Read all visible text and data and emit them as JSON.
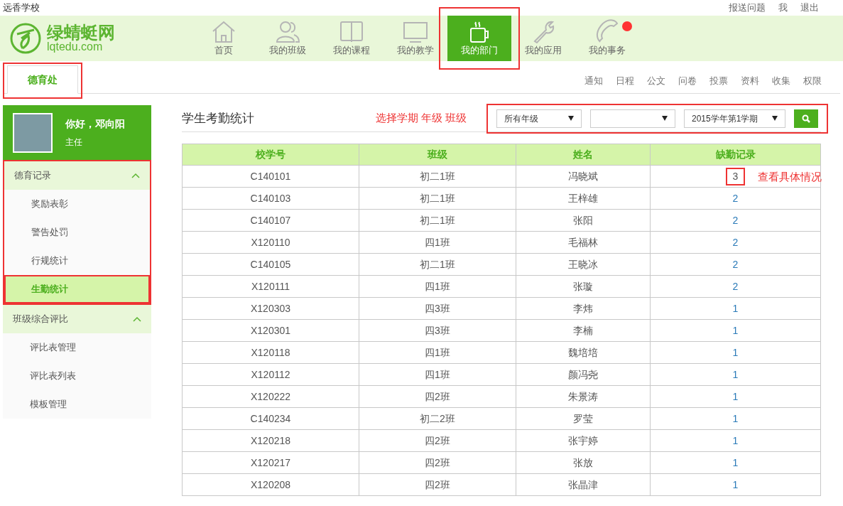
{
  "school_name": "远香学校",
  "top_links": [
    "报送问题",
    "我",
    "退出"
  ],
  "logo": {
    "name": "绿蜻蜓网",
    "domain": "lqtedu.com"
  },
  "nav": [
    {
      "label": "首页",
      "kind": "home",
      "selected": false,
      "badge": false,
      "annotated": false
    },
    {
      "label": "我的班级",
      "kind": "people",
      "selected": false,
      "badge": false,
      "annotated": false
    },
    {
      "label": "我的课程",
      "kind": "book",
      "selected": false,
      "badge": false,
      "annotated": false
    },
    {
      "label": "我的教学",
      "kind": "monitor",
      "selected": false,
      "badge": false,
      "annotated": false
    },
    {
      "label": "我的部门",
      "kind": "cup",
      "selected": true,
      "badge": false,
      "annotated": true
    },
    {
      "label": "我的应用",
      "kind": "wrench",
      "selected": false,
      "badge": false,
      "annotated": false
    },
    {
      "label": "我的事务",
      "kind": "phone",
      "selected": false,
      "badge": true,
      "annotated": false
    }
  ],
  "dept_tab": {
    "label": "德育处",
    "selected": true,
    "annotated": true
  },
  "sub_nav": [
    "通知",
    "日程",
    "公文",
    "问卷",
    "投票",
    "资料",
    "收集",
    "权限"
  ],
  "user": {
    "greeting": "你好，邓向阳",
    "role": "主任"
  },
  "sidebar": [
    {
      "title": "德育记录",
      "expanded": true,
      "annotated": true,
      "children": [
        {
          "label": "奖励表彰",
          "selected": false,
          "annotated": false
        },
        {
          "label": "警告处罚",
          "selected": false,
          "annotated": false
        },
        {
          "label": "行规统计",
          "selected": false,
          "annotated": false
        },
        {
          "label": "生勤统计",
          "selected": true,
          "annotated": true
        }
      ]
    },
    {
      "title": "班级综合评比",
      "expanded": true,
      "annotated": false,
      "children": [
        {
          "label": "评比表管理",
          "selected": false,
          "annotated": false
        },
        {
          "label": "评比表列表",
          "selected": false,
          "annotated": false
        },
        {
          "label": "模板管理",
          "selected": false,
          "annotated": false
        }
      ]
    }
  ],
  "page_title": "学生考勤统计",
  "filter_note": "选择学期 年级 班级",
  "filters": {
    "annotated": true,
    "grade": "所有年级",
    "term": "2015学年第1学期"
  },
  "table": {
    "columns": [
      "校学号",
      "班级",
      "姓名",
      "缺勤记录"
    ],
    "rows": [
      {
        "id": "C140101",
        "class": "初二1班",
        "name": "冯晓斌",
        "absences": "3",
        "annotated": true,
        "note": "查看具体情况"
      },
      {
        "id": "C140103",
        "class": "初二1班",
        "name": "王梓雄",
        "absences": "2",
        "annotated": false
      },
      {
        "id": "C140107",
        "class": "初二1班",
        "name": "张阳",
        "absences": "2",
        "annotated": false
      },
      {
        "id": "X120110",
        "class": "四1班",
        "name": "毛福林",
        "absences": "2",
        "annotated": false
      },
      {
        "id": "C140105",
        "class": "初二1班",
        "name": "王晓冰",
        "absences": "2",
        "annotated": false
      },
      {
        "id": "X120111",
        "class": "四1班",
        "name": "张璇",
        "absences": "2",
        "annotated": false
      },
      {
        "id": "X120303",
        "class": "四3班",
        "name": "李炜",
        "absences": "1",
        "annotated": false
      },
      {
        "id": "X120301",
        "class": "四3班",
        "name": "李楠",
        "absences": "1",
        "annotated": false
      },
      {
        "id": "X120118",
        "class": "四1班",
        "name": "魏培培",
        "absences": "1",
        "annotated": false
      },
      {
        "id": "X120112",
        "class": "四1班",
        "name": "颜冯尧",
        "absences": "1",
        "annotated": false
      },
      {
        "id": "X120222",
        "class": "四2班",
        "name": "朱景涛",
        "absences": "1",
        "annotated": false
      },
      {
        "id": "C140234",
        "class": "初二2班",
        "name": "罗莹",
        "absences": "1",
        "annotated": false
      },
      {
        "id": "X120218",
        "class": "四2班",
        "name": "张宇婷",
        "absences": "1",
        "annotated": false
      },
      {
        "id": "X120217",
        "class": "四2班",
        "name": "张放",
        "absences": "1",
        "annotated": false
      },
      {
        "id": "X120208",
        "class": "四2班",
        "name": "张晶津",
        "absences": "1",
        "annotated": false
      }
    ]
  }
}
